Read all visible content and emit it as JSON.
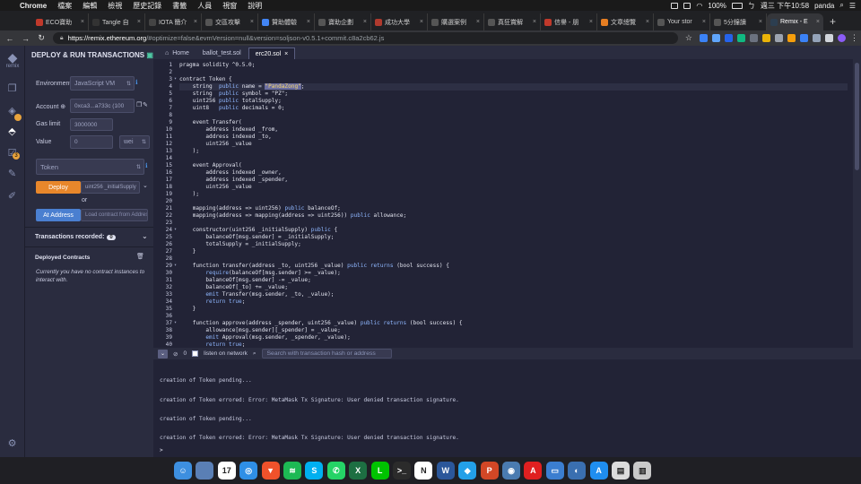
{
  "menubar": {
    "app": "Chrome",
    "items": [
      "檔案",
      "編輯",
      "檢視",
      "歷史記錄",
      "書籤",
      "人員",
      "視窗",
      "說明"
    ],
    "battery": "100%",
    "clock": "週三 下午10:58",
    "user": "panda"
  },
  "tabs": [
    {
      "label": "ECO寶助",
      "color": "#c0392b"
    },
    {
      "label": "Tangle 自",
      "color": "#333333"
    },
    {
      "label": "IOTA 簡介",
      "color": "#444444"
    },
    {
      "label": "交區攻擊",
      "color": "#555555"
    },
    {
      "label": "贊助體驗",
      "color": "#4285f4"
    },
    {
      "label": "寶助企劃",
      "color": "#555555"
    },
    {
      "label": "成功大學",
      "color": "#b03a2e"
    },
    {
      "label": "購選案例",
      "color": "#555555"
    },
    {
      "label": "真狂賞解",
      "color": "#555555"
    },
    {
      "label": "信譽 - 朋",
      "color": "#c0392b"
    },
    {
      "label": "文章總覽",
      "color": "#e67e22"
    },
    {
      "label": "Your stor",
      "color": "#555555"
    },
    {
      "label": "5分鐘讀",
      "color": "#555555"
    },
    {
      "label": "Remix - E",
      "color": "#2c3e50"
    }
  ],
  "url": {
    "host": "https://remix.ethereum.org",
    "rest": "/#optimize=false&evmVersion=null&version=soljson-v0.5.1+commit.c8a2cb62.js"
  },
  "remix_logo": "remix",
  "sidebar": {
    "title": "DEPLOY & RUN TRANSACTIONS",
    "environment_label": "Environment",
    "environment_value": "JavaScript VM",
    "account_label": "Account",
    "account_value": "0xca3...a733c (100",
    "gas_limit_label": "Gas limit",
    "gas_limit_value": "3000000",
    "value_label": "Value",
    "value_value": "0",
    "value_unit": "wei",
    "contract_value": "Token",
    "deploy_label": "Deploy",
    "deploy_param_placeholder": "uint256 _initialSupply",
    "or_label": "or",
    "at_address_label": "At Address",
    "at_address_placeholder": "Load contract from Address",
    "transactions_label": "Transactions recorded:",
    "transactions_count": "0",
    "deployed_label": "Deployed Contracts",
    "no_instances": "Currently you have no contract instances to interact with."
  },
  "editor_tabs": [
    {
      "label": "Home",
      "icon": "home-icon"
    },
    {
      "label": "ballot_test.sol"
    },
    {
      "label": "erc20.sol",
      "close": "×"
    }
  ],
  "code_lines": [
    {
      "n": "1",
      "t": "pragma solidity ^0.5.0;"
    },
    {
      "n": "2",
      "t": ""
    },
    {
      "n": "3",
      "t": "contract Token {",
      "fold": true
    },
    {
      "n": "4",
      "t": "    string  public name = ",
      "sel": "\"PandaZong\"",
      "after": ";",
      "hl": true
    },
    {
      "n": "5",
      "t": "    string  public symbol = \"PZ\";"
    },
    {
      "n": "6",
      "t": "    uint256 public totalSupply;"
    },
    {
      "n": "7",
      "t": "    uint8   public decimals = 0;"
    },
    {
      "n": "8",
      "t": ""
    },
    {
      "n": "9",
      "t": "    event Transfer("
    },
    {
      "n": "10",
      "t": "        address indexed _from,"
    },
    {
      "n": "11",
      "t": "        address indexed _to,"
    },
    {
      "n": "12",
      "t": "        uint256 _value"
    },
    {
      "n": "13",
      "t": "    );"
    },
    {
      "n": "14",
      "t": ""
    },
    {
      "n": "15",
      "t": "    event Approval("
    },
    {
      "n": "16",
      "t": "        address indexed _owner,"
    },
    {
      "n": "17",
      "t": "        address indexed _spender,"
    },
    {
      "n": "18",
      "t": "        uint256 _value"
    },
    {
      "n": "19",
      "t": "    );"
    },
    {
      "n": "20",
      "t": ""
    },
    {
      "n": "21",
      "t": "    mapping(address => uint256) public balanceOf;"
    },
    {
      "n": "22",
      "t": "    mapping(address => mapping(address => uint256)) public allowance;"
    },
    {
      "n": "23",
      "t": ""
    },
    {
      "n": "24",
      "t": "    constructor(uint256 _initialSupply) public {",
      "fold": true
    },
    {
      "n": "25",
      "t": "        balanceOf[msg.sender] = _initialSupply;"
    },
    {
      "n": "26",
      "t": "        totalSupply = _initialSupply;"
    },
    {
      "n": "27",
      "t": "    }"
    },
    {
      "n": "28",
      "t": ""
    },
    {
      "n": "29",
      "t": "    function transfer(address _to, uint256 _value) public returns (bool success) {",
      "fold": true
    },
    {
      "n": "30",
      "t": "        require(balanceOf[msg.sender] >= _value);"
    },
    {
      "n": "31",
      "t": "        balanceOf[msg.sender] -= _value;"
    },
    {
      "n": "32",
      "t": "        balanceOf[_to] += _value;"
    },
    {
      "n": "33",
      "t": "        emit Transfer(msg.sender, _to, _value);"
    },
    {
      "n": "34",
      "t": "        return true;"
    },
    {
      "n": "35",
      "t": "    }"
    },
    {
      "n": "36",
      "t": ""
    },
    {
      "n": "37",
      "t": "    function approve(address _spender, uint256 _value) public returns (bool success) {",
      "fold": true
    },
    {
      "n": "38",
      "t": "        allowance[msg.sender][_spender] = _value;"
    },
    {
      "n": "39",
      "t": "        emit Approval(msg.sender, _spender, _value);"
    },
    {
      "n": "40",
      "t": "        return true;"
    }
  ],
  "terminal": {
    "pending_count": "0",
    "listen_label": "listen on network",
    "search_placeholder": "Search with transaction hash or address",
    "lines": [
      "creation of Token pending...",
      "creation of Token errored: Error: MetaMask Tx Signature: User denied transaction signature.",
      "creation of Token pending...",
      "creation of Token errored: Error: MetaMask Tx Signature: User denied transaction signature."
    ],
    "prompt": ">"
  },
  "dock": [
    {
      "name": "finder-icon",
      "color": "#3d8fe0",
      "glyph": "☺"
    },
    {
      "name": "preview-icon",
      "color": "#5a7fb5",
      "glyph": ""
    },
    {
      "name": "calendar-icon",
      "color": "#ffffff",
      "glyph": "17"
    },
    {
      "name": "safari-icon",
      "color": "#2f8fe6",
      "glyph": "◎"
    },
    {
      "name": "brave-icon",
      "color": "#f0522b",
      "glyph": "▼"
    },
    {
      "name": "spotify-icon",
      "color": "#1db954",
      "glyph": "≋"
    },
    {
      "name": "skype-icon",
      "color": "#00aff0",
      "glyph": "S"
    },
    {
      "name": "whatsapp-icon",
      "color": "#25d366",
      "glyph": "✆"
    },
    {
      "name": "excel-icon",
      "color": "#1d6f42",
      "glyph": "X"
    },
    {
      "name": "line-icon",
      "color": "#00c300",
      "glyph": "L"
    },
    {
      "name": "terminal-icon",
      "color": "#2b2b2b",
      "glyph": ">_"
    },
    {
      "name": "notion-icon",
      "color": "#ffffff",
      "glyph": "N"
    },
    {
      "name": "word-icon",
      "color": "#2b579a",
      "glyph": "W"
    },
    {
      "name": "vscode-icon",
      "color": "#23a0e8",
      "glyph": "◆"
    },
    {
      "name": "powerpoint-icon",
      "color": "#d24726",
      "glyph": "P"
    },
    {
      "name": "camera-icon",
      "color": "#4a7bb0",
      "glyph": "◉"
    },
    {
      "name": "acrobat-icon",
      "color": "#e02020",
      "glyph": "A"
    },
    {
      "name": "keynote-icon",
      "color": "#3b7ed0",
      "glyph": "▭"
    },
    {
      "name": "network-icon",
      "color": "#3a6fb0",
      "glyph": "◐"
    },
    {
      "name": "appstore-icon",
      "color": "#1f8ef0",
      "glyph": "A"
    },
    {
      "name": "documents-icon",
      "color": "#dcdcdc",
      "glyph": "▤"
    },
    {
      "name": "trash-icon",
      "color": "#c9c9c9",
      "glyph": "▥"
    }
  ]
}
